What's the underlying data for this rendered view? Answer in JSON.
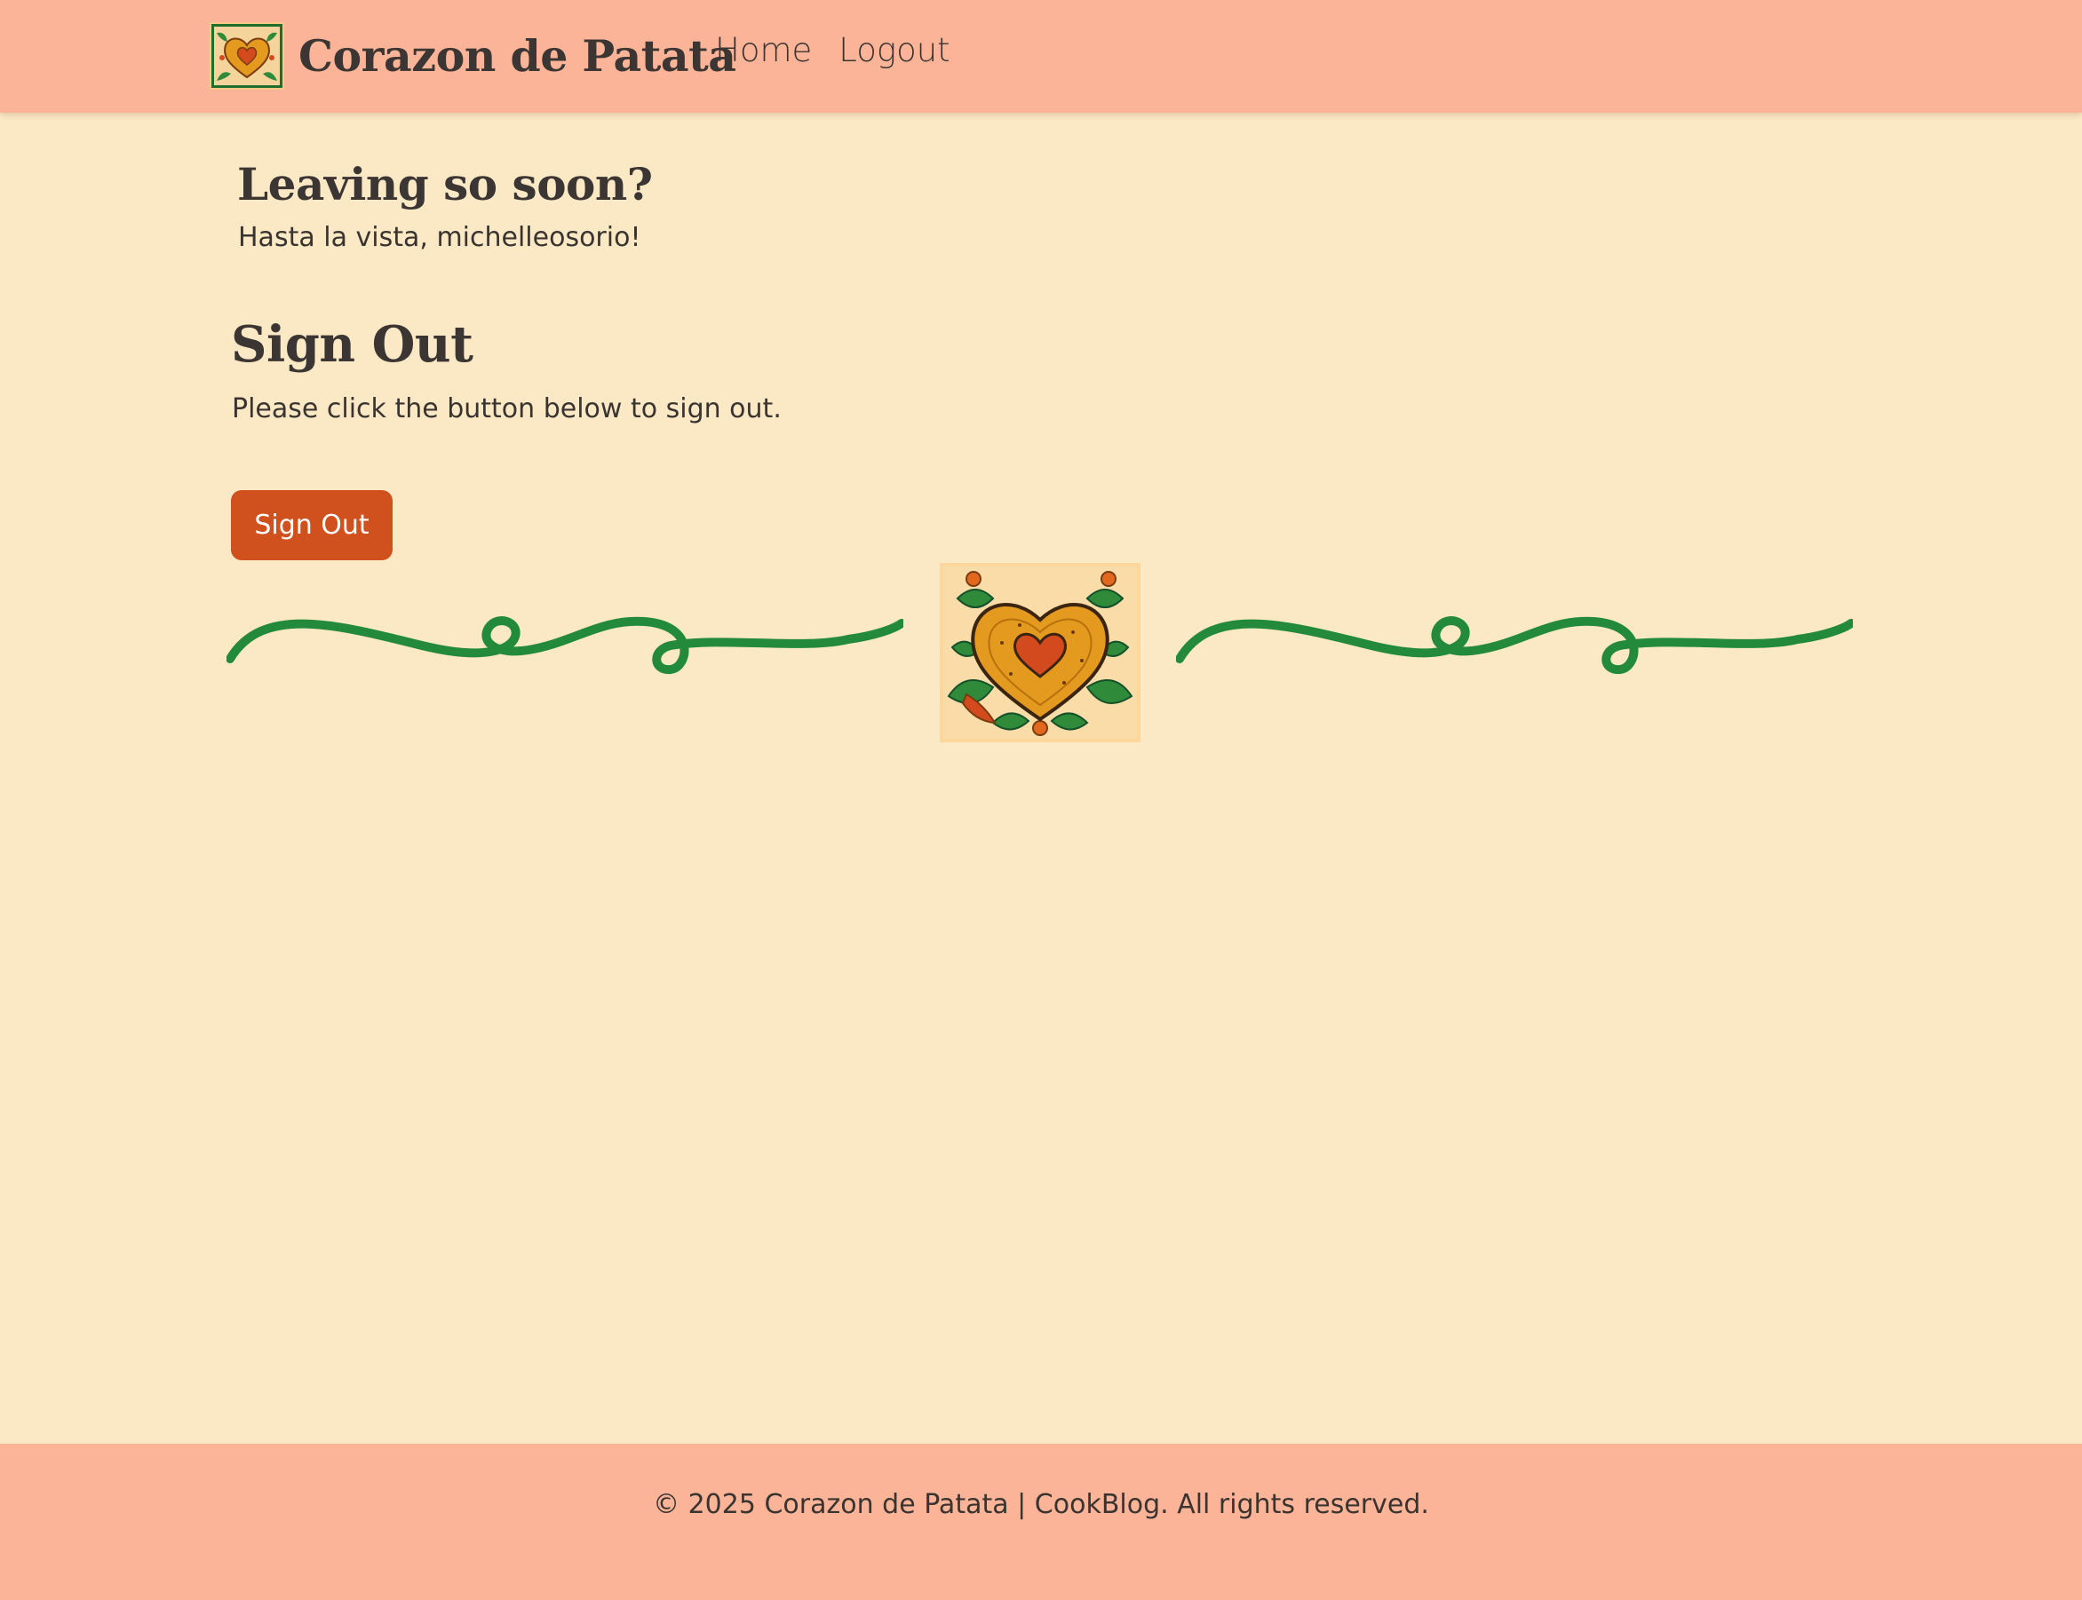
{
  "header": {
    "brand_name": "Corazon de Patata",
    "nav": {
      "home": "Home",
      "logout": "Logout"
    }
  },
  "main": {
    "leaving_title": "Leaving so soon?",
    "leaving_subtitle": "Hasta la vista, michelleosorio!",
    "signout_title": "Sign Out",
    "signout_description": "Please click the button below to sign out.",
    "signout_button": "Sign Out"
  },
  "footer": {
    "text": "© 2025 Corazon de Patata | CookBlog. All rights reserved."
  },
  "icons": {
    "brand": "heart-tile-logo-icon",
    "divider_left": "vine-swirl-icon",
    "divider_center": "heart-tile-emblem-icon",
    "divider_right": "vine-swirl-icon"
  },
  "colors": {
    "page_background": "#fbe9c5",
    "header_footer": "#fbb497",
    "button": "#d0501e",
    "vine_green": "#238a3c",
    "heart_orange": "#e49a1e",
    "heart_red": "#d44a1f"
  }
}
